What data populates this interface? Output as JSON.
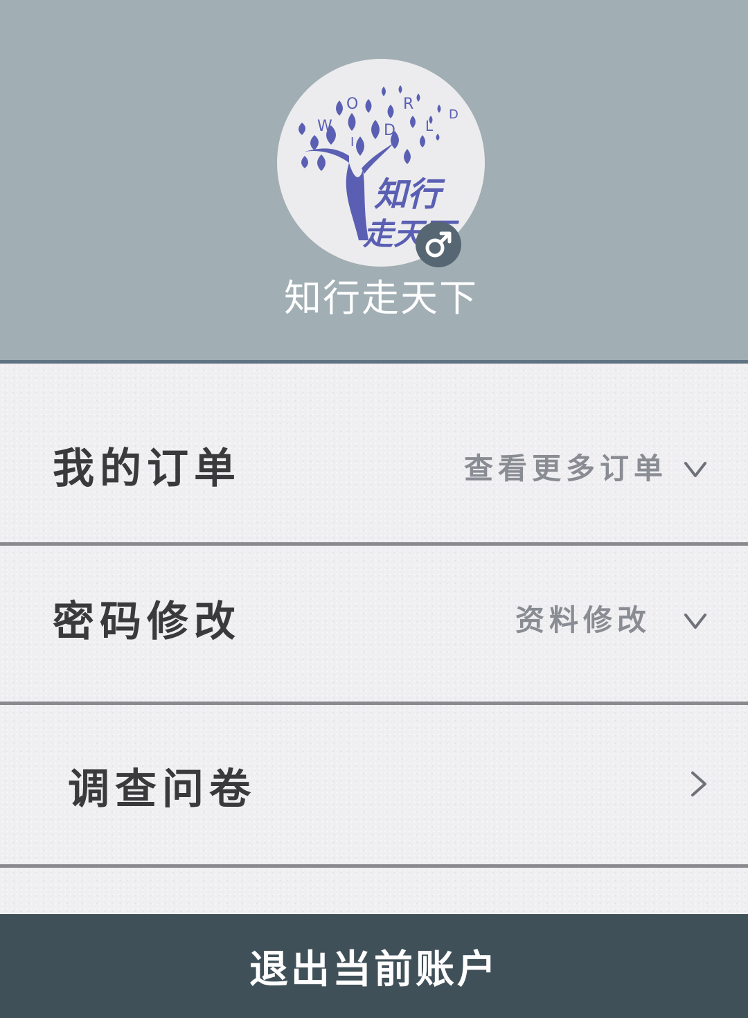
{
  "profile": {
    "avatar_logo_text": "知行走天下",
    "avatar_letters": "WORLD",
    "gender_symbol": "♂",
    "username": "知行走天下"
  },
  "menu": {
    "orders": {
      "title": "我的订单",
      "action_label": "查看更多订单",
      "chevron_icon": "chevron-down-icon"
    },
    "password": {
      "title": "密码修改",
      "action_label": "资料修改",
      "chevron_icon": "chevron-down-icon"
    },
    "survey": {
      "title": "调查问卷",
      "chevron_icon": "chevron-right-icon"
    }
  },
  "logout": {
    "label": "退出当前账户"
  },
  "colors": {
    "header_bg": "#a1aeb4",
    "header_border": "#5f7282",
    "logo_blue": "#5a5fb3",
    "badge_bg": "#566673",
    "logout_bg": "#405059",
    "divider": "#8a8a8e"
  }
}
